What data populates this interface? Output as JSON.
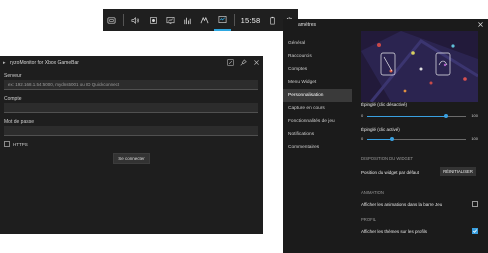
{
  "topbar": {
    "time": "15:58",
    "icons": [
      "widget-menu-icon",
      "audio-icon",
      "capture-icon",
      "performance-icon",
      "resources-icon",
      "xbox-social-icon",
      "ryzomonitor-icon",
      "battery-icon",
      "settings-icon"
    ],
    "active_icon": "ryzomonitor-icon",
    "accent": "#2ea7e0"
  },
  "widget": {
    "title": "ryzoMonitor for Xbox GameBar",
    "server_label": "Serveur",
    "server_placeholder": "ex: 192.168.1.54:5000, mydns5001 ou ID Quickconnect",
    "account_label": "Compte",
    "account_value": "",
    "password_label": "Mot de passe",
    "password_value": "",
    "https_label": "HTTPS",
    "https_checked": false,
    "connect_label": "Se connecter"
  },
  "settings": {
    "title": "amètres",
    "nav": [
      "Général",
      "Raccourcis",
      "Comptes",
      "Menu Widget",
      "Personnalisation",
      "Capture en cours",
      "Fonctionnalités de jeu",
      "Notifications",
      "Commentaires"
    ],
    "selected_nav": 4,
    "slider1": {
      "label": "Épinglé (clic désactivé)",
      "min": "0",
      "max": "100",
      "value": 80
    },
    "slider2": {
      "label": "Épinglé (clic activé)",
      "min": "0",
      "max": "100",
      "value": 25
    },
    "widget_section": "DISPOSITION DU WIDGET",
    "widget_position_label": "Position du widget par défaut",
    "reset_label": "RÉINITIALISER",
    "animation_section": "ANIMATION",
    "animation_label": "Afficher les animations dans la barre Jeu",
    "animation_checked": false,
    "profile_section": "PROFIL",
    "profile_label": "Afficher les thèmes sur les profils",
    "profile_checked": true,
    "accent": "#3aa0e0"
  }
}
